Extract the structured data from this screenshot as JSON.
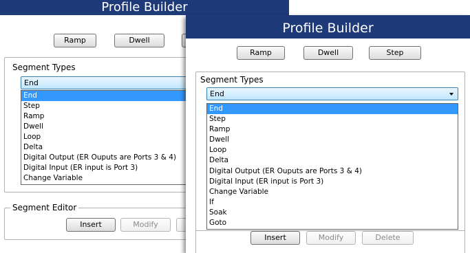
{
  "back_window": {
    "title": "Profile Builder",
    "buttons": {
      "ramp": "Ramp",
      "dwell": "Dwell"
    },
    "segment_types": {
      "label": "Segment Types",
      "selected": "End",
      "options": [
        "End",
        "Step",
        "Ramp",
        "Dwell",
        "Loop",
        "Delta",
        "Digital Output (ER Ouputs are Ports 3 & 4)",
        "Digital Input (ER input is Port 3)",
        "Change Variable"
      ]
    },
    "segment_editor": {
      "label": "Segment Editor",
      "insert": "Insert",
      "modify": "Modify"
    }
  },
  "front_window": {
    "title": "Profile Builder",
    "buttons": {
      "ramp": "Ramp",
      "dwell": "Dwell",
      "step": "Step"
    },
    "segment_types": {
      "label": "Segment Types",
      "selected": "End",
      "options": [
        "End",
        "Step",
        "Ramp",
        "Dwell",
        "Loop",
        "Delta",
        "Digital Output (ER Ouputs are Ports 3 & 4)",
        "Digital Input (ER input is Port 3)",
        "Change Variable",
        "If",
        "Soak",
        "Goto"
      ]
    },
    "segment_editor": {
      "insert": "Insert",
      "modify": "Modify",
      "delete": "Delete"
    }
  },
  "colors": {
    "titlebar": "#1e3a78",
    "selection": "#3399ff"
  }
}
